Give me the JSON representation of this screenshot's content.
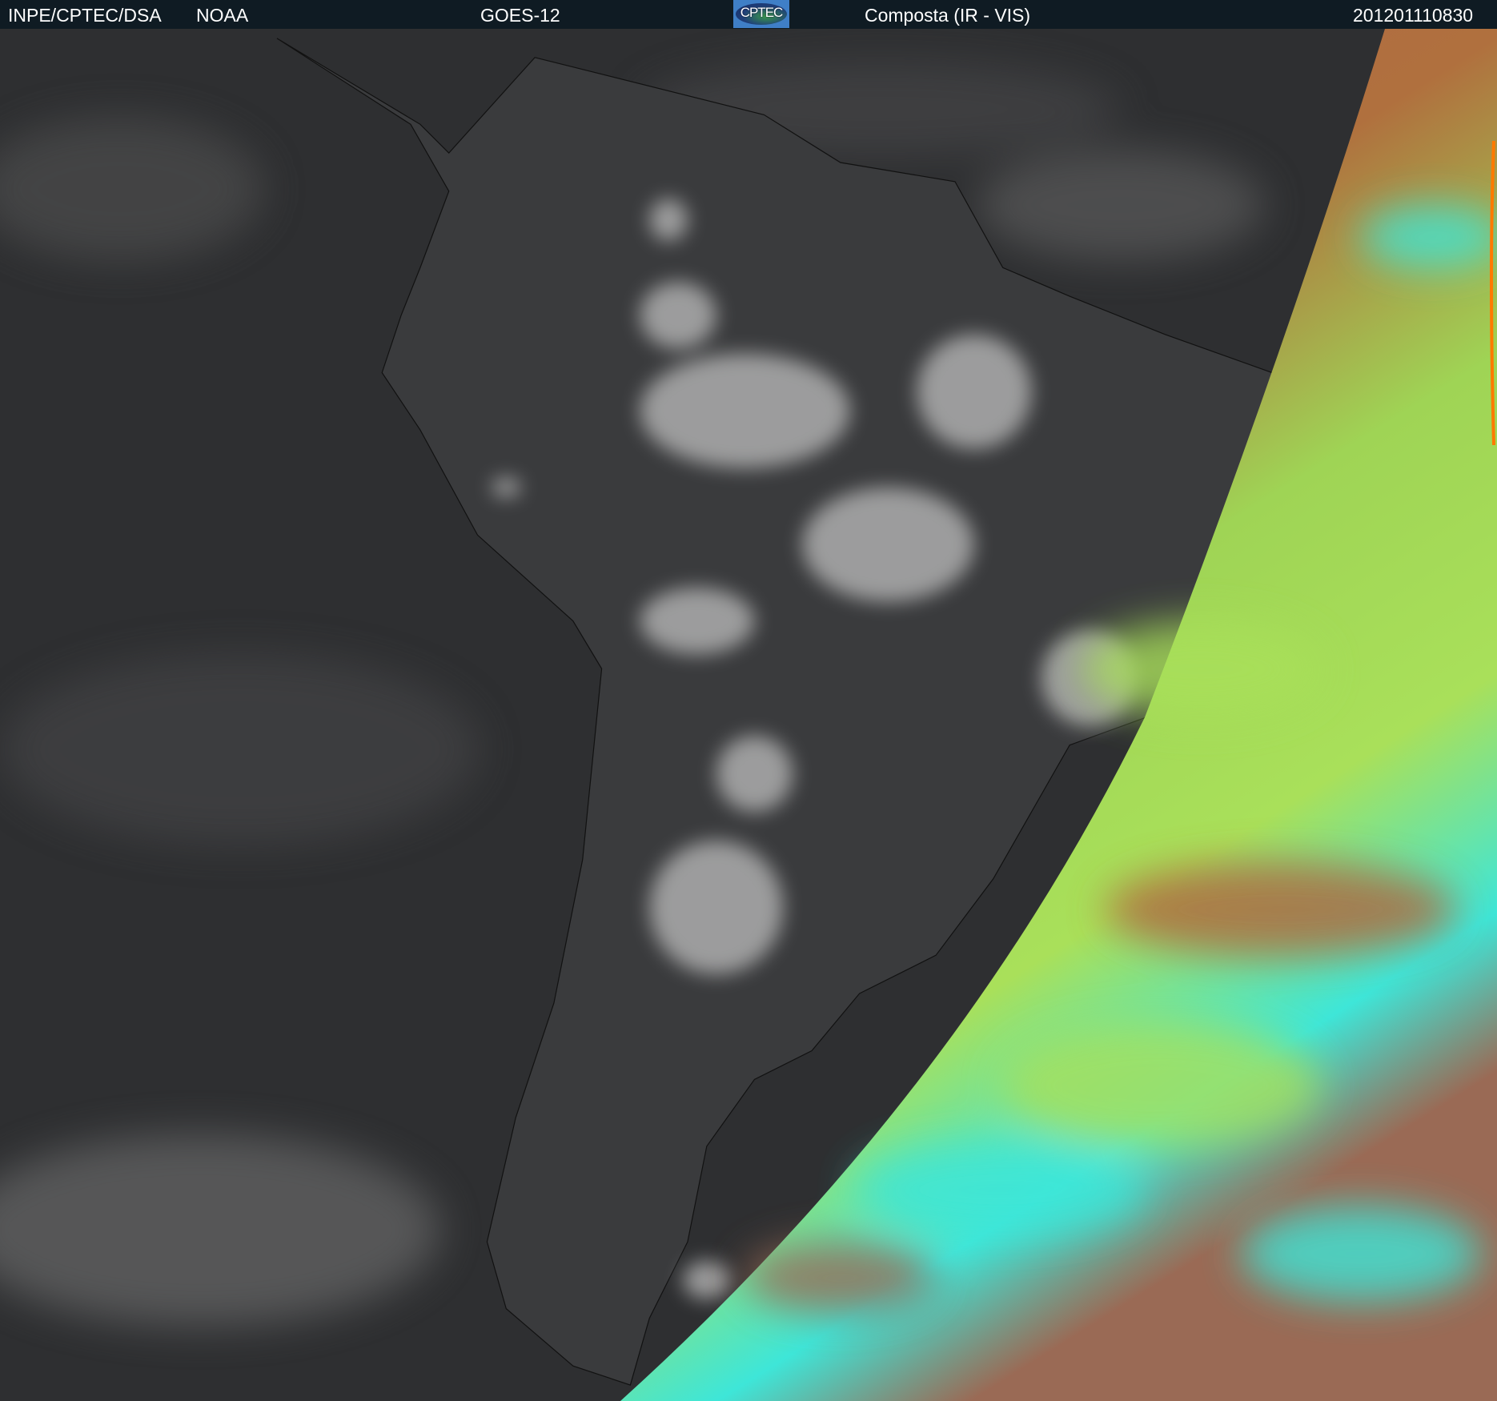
{
  "header": {
    "institution": "INPE/CPTEC/DSA",
    "agency": "NOAA",
    "satellite": "GOES-12",
    "logo_text": "CPTEC",
    "product": "Composta (IR - VIS)",
    "timestamp": "201201110830"
  },
  "colors": {
    "header_bg": "#0f1b23",
    "ir_background": "#2e2f31",
    "vis_orange": "#b5654a",
    "vis_green": "#a9e05a",
    "vis_cyan": "#3ee6d8"
  }
}
